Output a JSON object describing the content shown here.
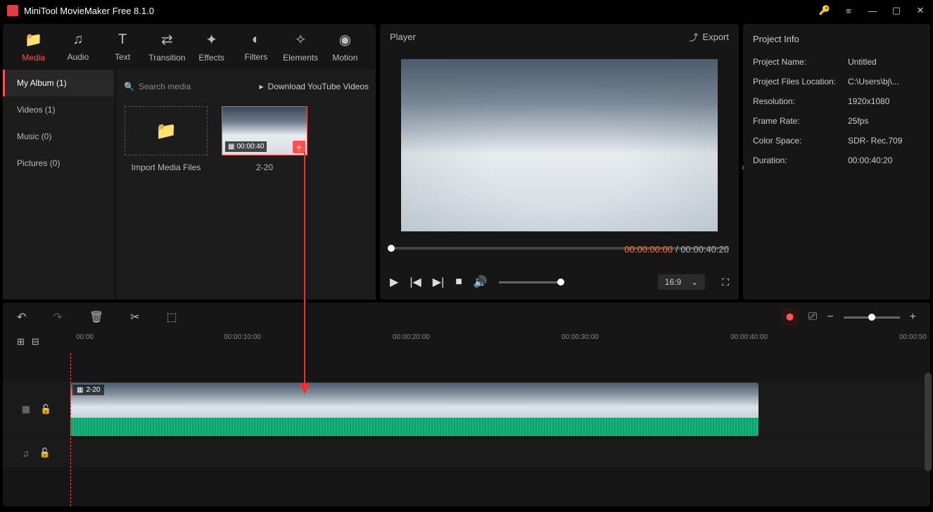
{
  "title": "MiniTool MovieMaker Free 8.1.0",
  "tabs": {
    "media": "Media",
    "audio": "Audio",
    "text": "Text",
    "transition": "Transition",
    "effects": "Effects",
    "filters": "Filters",
    "elements": "Elements",
    "motion": "Motion"
  },
  "sidebar": {
    "album": "My Album (1)",
    "videos": "Videos (1)",
    "music": "Music (0)",
    "pictures": "Pictures (0)"
  },
  "media": {
    "search_placeholder": "Search media",
    "download": "Download YouTube Videos",
    "import": "Import Media Files",
    "clip_duration": "00:00:40",
    "clip_name": "2-20"
  },
  "player": {
    "title": "Player",
    "export": "Export",
    "current": "00:00:00:00",
    "sep": " / ",
    "total": "00:00:40:20",
    "aspect": "16:9"
  },
  "info": {
    "title": "Project Info",
    "rows": {
      "name_k": "Project Name:",
      "name_v": "Untitled",
      "loc_k": "Project Files Location:",
      "loc_v": "C:\\Users\\bj\\...",
      "res_k": "Resolution:",
      "res_v": "1920x1080",
      "fps_k": "Frame Rate:",
      "fps_v": "25fps",
      "cs_k": "Color Space:",
      "cs_v": "SDR- Rec.709",
      "dur_k": "Duration:",
      "dur_v": "00:00:40:20"
    }
  },
  "ruler": {
    "t0": "00:00",
    "t1": "00:00:10:00",
    "t2": "00:00:20:00",
    "t3": "00:00:30:00",
    "t4": "00:00:40:00",
    "t5": "00:00:50"
  },
  "clip_label": "2-20"
}
